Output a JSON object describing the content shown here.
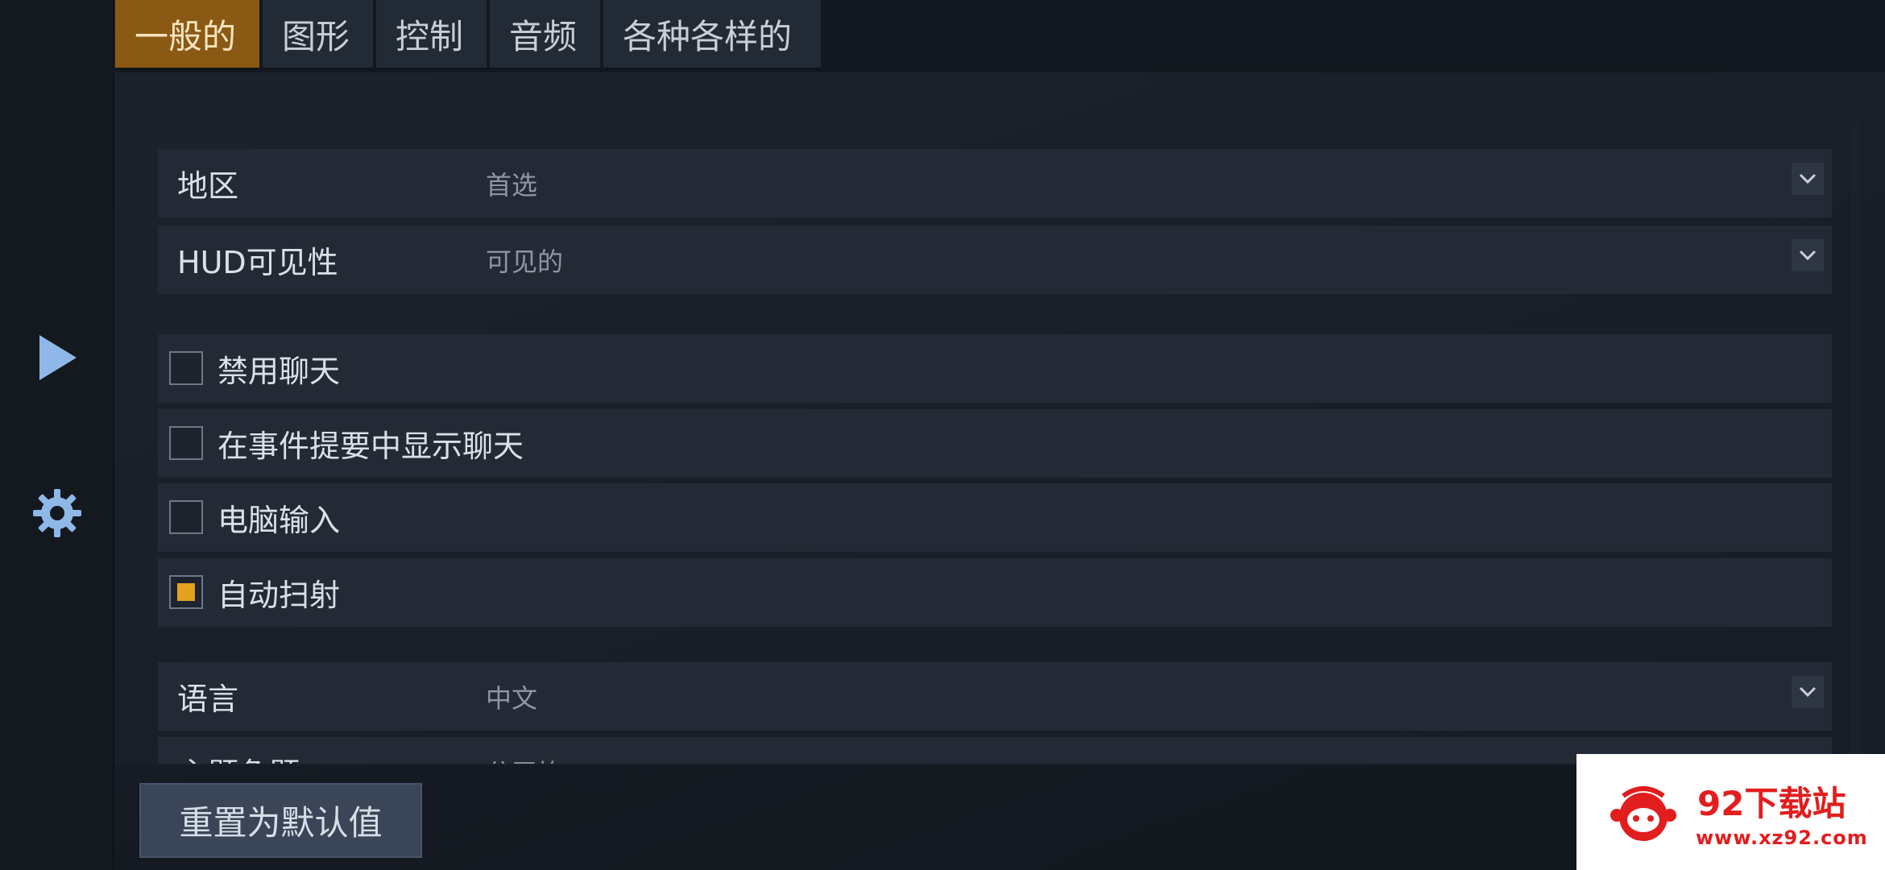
{
  "tabs": [
    {
      "label": "一般的",
      "active": true
    },
    {
      "label": "图形",
      "active": false
    },
    {
      "label": "控制",
      "active": false
    },
    {
      "label": "音频",
      "active": false
    },
    {
      "label": "各种各样的",
      "active": false
    }
  ],
  "rail": {
    "play_icon": "play-icon",
    "settings_icon": "gear-icon"
  },
  "settings": {
    "region": {
      "label": "地区",
      "value": "首选"
    },
    "hud": {
      "label": "HUD可见性",
      "value": "可见的"
    },
    "disable_chat": {
      "label": "禁用聊天",
      "checked": false
    },
    "event_chat": {
      "label": "在事件提要中显示聊天",
      "checked": false
    },
    "pc_input": {
      "label": "电脑输入",
      "checked": false
    },
    "auto_fire": {
      "label": "自动扫射",
      "checked": true
    },
    "language": {
      "label": "语言",
      "value": "中文"
    },
    "partial_row": {
      "label": "主题色题",
      "value": "分平均"
    }
  },
  "footer": {
    "reset_label": "重置为默认值"
  },
  "watermark": {
    "title": "92下载站",
    "url": "www.xz92.com"
  },
  "colors": {
    "accent_tab": "#8a5a14",
    "checkbox_fill": "#e3a11f",
    "rail_icon": "#8fb8e8",
    "watermark_red": "#e21d1d"
  }
}
